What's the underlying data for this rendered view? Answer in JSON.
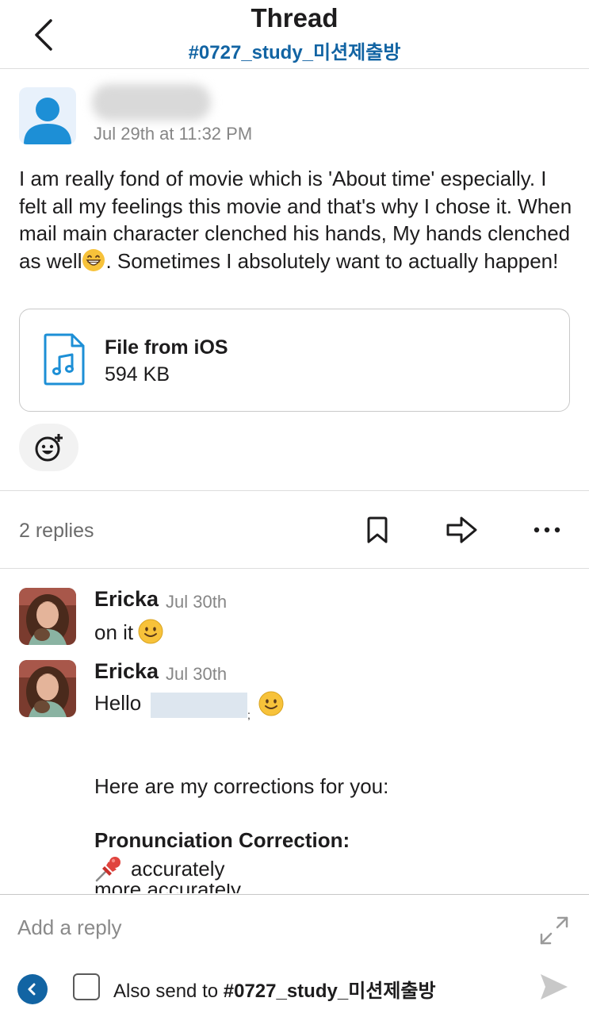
{
  "header": {
    "title": "Thread",
    "channel": "#0727_study_미션제출방"
  },
  "parent_message": {
    "timestamp": "Jul 29th at 11:32 PM",
    "text": "I am really fond of movie which is 'About time' especially. I felt all my feelings this movie and that's why I chose it. When mail main character clenched his hands, My hands clenched as well",
    "text_tail": ".  Sometimes I absolutely want to actually happen!",
    "attachment": {
      "name": "File from iOS",
      "size": "594 KB",
      "icon": "audio-file-icon"
    }
  },
  "thread_bar": {
    "replies_label": "2 replies"
  },
  "replies": [
    {
      "author": "Ericka",
      "time": "Jul 30th",
      "text": "on it"
    },
    {
      "author": "Ericka",
      "time": "Jul 30th",
      "greeting": "Hello",
      "redacted_tail": ";",
      "intro": "Here are my corrections for you:",
      "heading": "Pronunciation Correction:",
      "item": "accurately",
      "clipped_line": "more accurately"
    }
  ],
  "composer": {
    "placeholder": "Add a reply",
    "also_send_prefix": "Also send to ",
    "also_send_channel": "#0727_study_미션제출방"
  },
  "colors": {
    "link_blue": "#1264a3",
    "divider": "#dddddd",
    "muted_text": "#868686",
    "emoji_yellow": "#f7c23a"
  }
}
